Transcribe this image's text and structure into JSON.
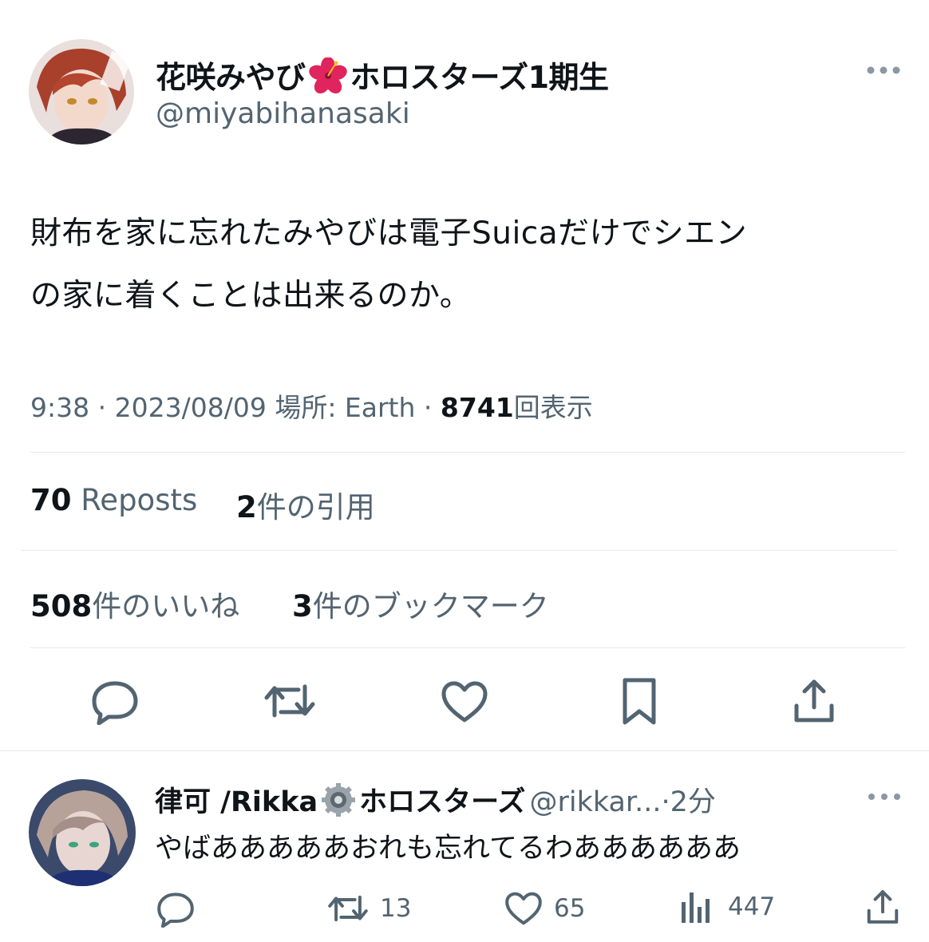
{
  "post": {
    "display_name_prefix": "花咲みやび",
    "display_name_suffix": "ホロスターズ1期生",
    "name_emoji": "hibiscus-emoji",
    "handle": "@miyabihanasaki",
    "text_line1": "財布を家に忘れたみやびは電子Suicaだけでシエン",
    "text_line2": "の家に着くことは出来るのか。",
    "time": "9:38",
    "date": "2023/08/09",
    "location_label": "場所: Earth",
    "views_count": "8741",
    "views_label": "回表示",
    "separator": "·",
    "reposts_count": "70",
    "reposts_label": "Reposts",
    "quotes_count": "2",
    "quotes_label": "件の引用",
    "likes_count": "508",
    "likes_label": "件のいいね",
    "bookmarks_count": "3",
    "bookmarks_label": "件のブックマーク"
  },
  "reply": {
    "display_name_prefix": "律可 /Rikka",
    "display_name_suffix": "ホロスターズ",
    "name_emoji": "gear-emoji",
    "handle": "@rikkar...",
    "separator": "·",
    "time_ago": "2分",
    "text": "やばあああああおれも忘れてるわああああああ",
    "retweet_count": "13",
    "like_count": "65",
    "views_count": "447"
  },
  "colors": {
    "text": "#0f1419",
    "secondary": "#536471",
    "divider": "#e6e9ec",
    "icon": "#536471",
    "hibiscus": "#e0245e"
  }
}
